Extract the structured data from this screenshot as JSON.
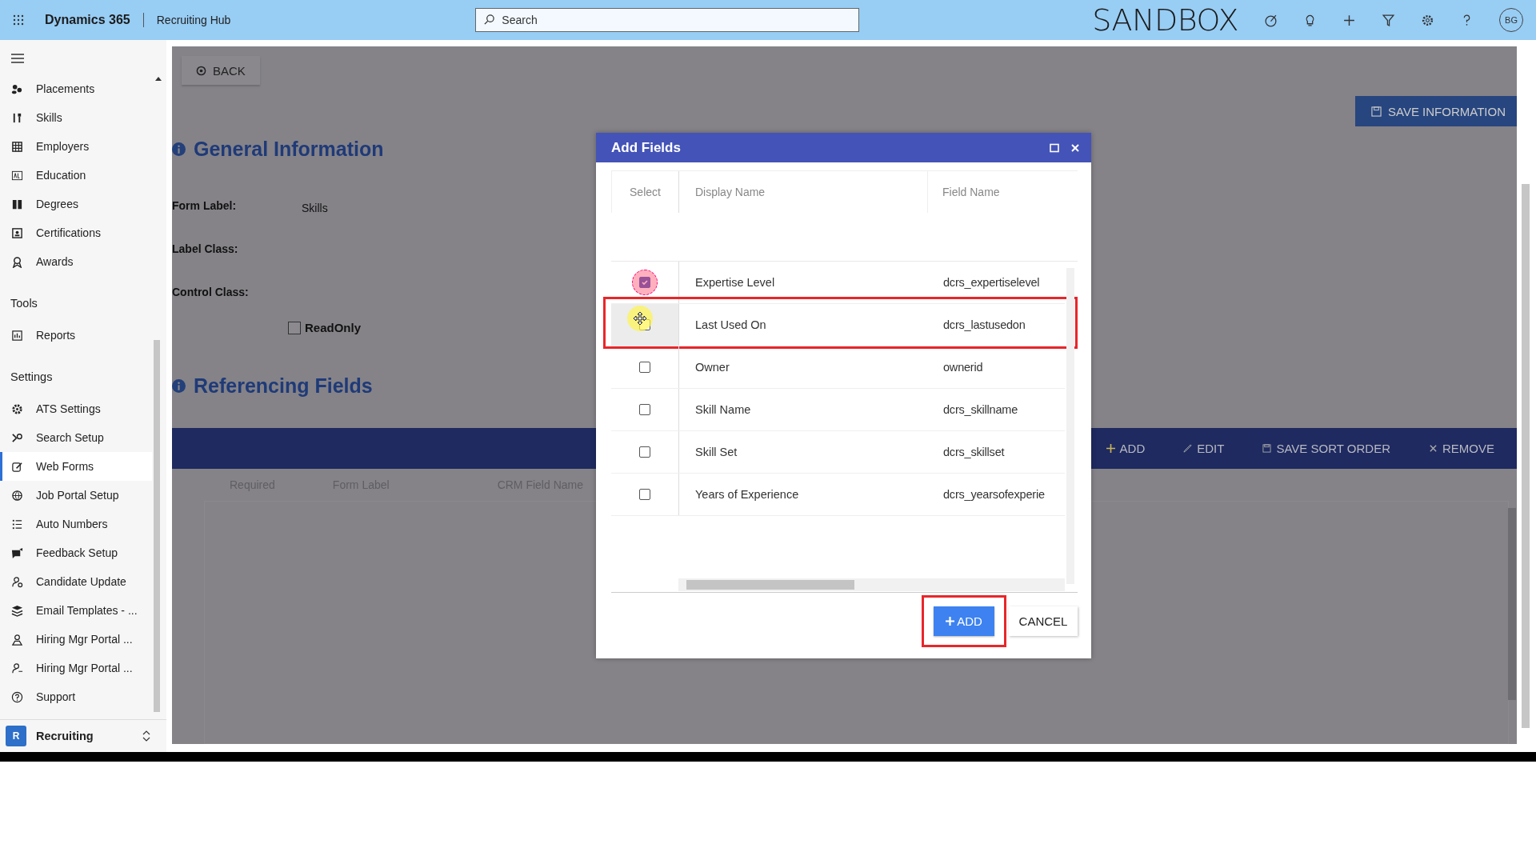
{
  "app": {
    "name": "Dynamics 365",
    "area": "Recruiting Hub",
    "search_placeholder": "Search",
    "environment": "SANDBOX",
    "avatar": "BG"
  },
  "sidebar": {
    "sections": [
      {
        "items": [
          {
            "label": "Placements",
            "selected": false
          },
          {
            "label": "Skills",
            "selected": false
          },
          {
            "label": "Employers",
            "selected": false
          },
          {
            "label": "Education",
            "selected": false
          },
          {
            "label": "Degrees",
            "selected": false
          },
          {
            "label": "Certifications",
            "selected": false
          },
          {
            "label": "Awards",
            "selected": false
          }
        ]
      },
      {
        "heading": "Tools",
        "items": [
          {
            "label": "Reports",
            "selected": false
          }
        ]
      },
      {
        "heading": "Settings",
        "items": [
          {
            "label": "ATS Settings",
            "selected": false
          },
          {
            "label": "Search Setup",
            "selected": false
          },
          {
            "label": "Web Forms",
            "selected": true
          },
          {
            "label": "Job Portal Setup",
            "selected": false
          },
          {
            "label": "Auto Numbers",
            "selected": false
          },
          {
            "label": "Feedback Setup",
            "selected": false
          },
          {
            "label": "Candidate Update",
            "selected": false
          },
          {
            "label": "Email Templates - ...",
            "selected": false
          },
          {
            "label": "Hiring Mgr Portal ...",
            "selected": false
          },
          {
            "label": "Hiring Mgr Portal ...",
            "selected": false
          },
          {
            "label": "Support",
            "selected": false
          }
        ]
      }
    ],
    "area_switcher": {
      "badge": "R",
      "label": "Recruiting"
    }
  },
  "page": {
    "back": "BACK",
    "save": "SAVE INFORMATION",
    "general_heading": "General Information",
    "fields": [
      {
        "label": "Form Label:",
        "value": "Skills"
      },
      {
        "label": "Label Class:"
      },
      {
        "label": "Control Class:"
      }
    ],
    "readonly": {
      "label": "ReadOnly",
      "checked": false
    },
    "referencing_heading": "Referencing Fields",
    "toolbar": [
      "ADD",
      "EDIT",
      "SAVE SORT ORDER",
      "REMOVE"
    ],
    "columns": [
      "Required",
      "Form Label",
      "CRM Field Name"
    ]
  },
  "dialog": {
    "title": "Add Fields",
    "columns": [
      "Select",
      "Display Name",
      "Field Name"
    ],
    "rows": [
      {
        "display_name": "Expertise Level",
        "field_name": "dcrs_expertiselevel",
        "checked": true,
        "highlighted": false,
        "clicked": true,
        "hovered": false
      },
      {
        "display_name": "Last Used On",
        "field_name": "dcrs_lastusedon",
        "checked": false,
        "highlighted": true,
        "clicked": false,
        "hovered": true
      },
      {
        "display_name": "Owner",
        "field_name": "ownerid",
        "checked": false,
        "highlighted": false,
        "clicked": false,
        "hovered": false
      },
      {
        "display_name": "Skill Name",
        "field_name": "dcrs_skillname",
        "checked": false,
        "highlighted": false,
        "clicked": false,
        "hovered": false
      },
      {
        "display_name": "Skill Set",
        "field_name": "dcrs_skillset",
        "checked": false,
        "highlighted": false,
        "clicked": false,
        "hovered": false
      },
      {
        "display_name": "Years of Experience",
        "field_name": "dcrs_yearsofexperie",
        "checked": false,
        "highlighted": false,
        "clicked": false,
        "hovered": false
      }
    ],
    "buttons": [
      {
        "label": "ADD",
        "kind": "primary",
        "highlighted": true
      },
      {
        "label": "CANCEL",
        "kind": "secondary",
        "highlighted": false
      }
    ]
  }
}
